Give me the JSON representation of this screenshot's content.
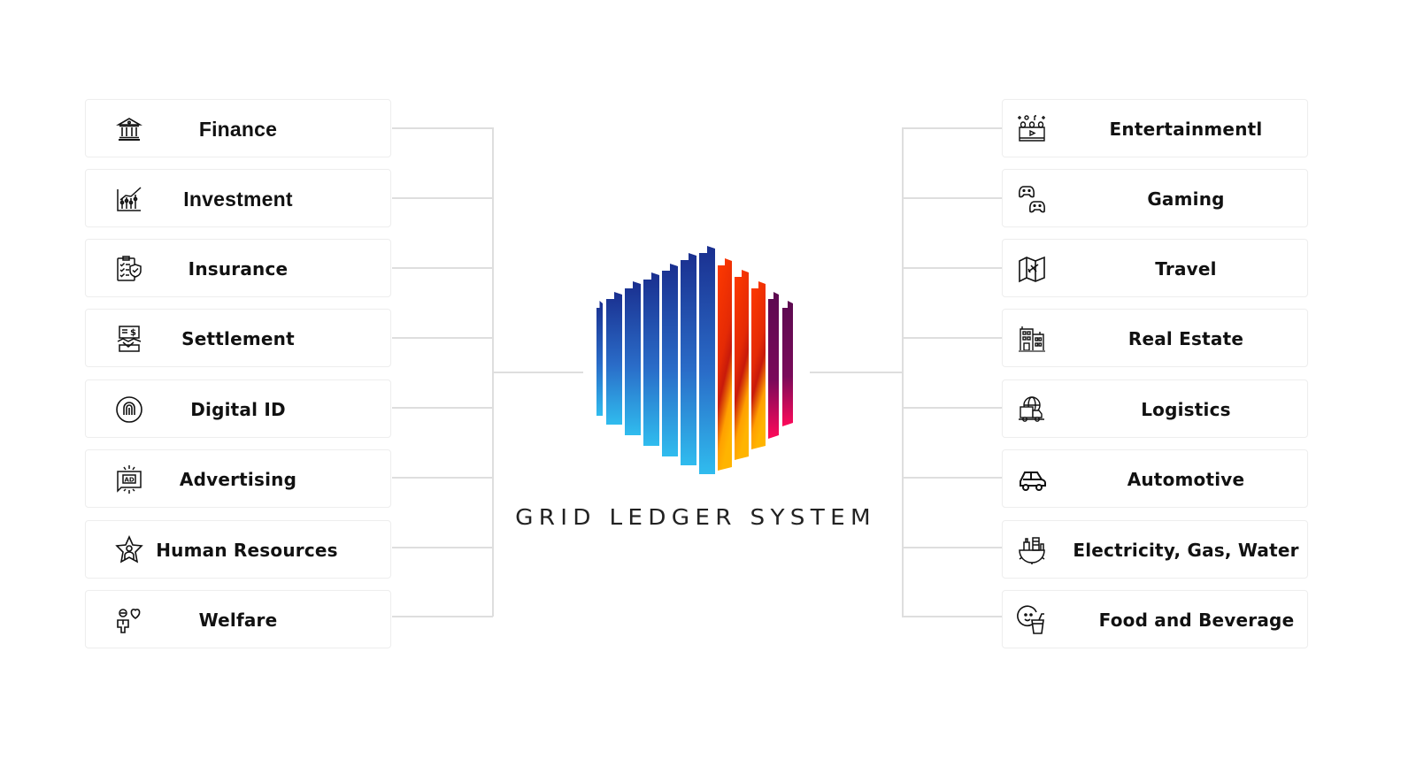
{
  "title": "GRID LEDGER SYSTEM",
  "logo": {
    "name": "grid-ledger-logo",
    "left_colors": [
      "#1a2f8f",
      "#2a7fd0",
      "#30b8ea"
    ],
    "right_colors": [
      "#ff3a00",
      "#c8160a",
      "#ffb000"
    ],
    "far_right_colors": [
      "#6a0a55",
      "#ff0a5a"
    ]
  },
  "left_items": [
    {
      "label": "Finance",
      "icon": "bank-icon"
    },
    {
      "label": "Investment",
      "icon": "stock-chart-icon"
    },
    {
      "label": "Insurance",
      "icon": "clipboard-shield-icon"
    },
    {
      "label": "Settlement",
      "icon": "handshake-bill-icon"
    },
    {
      "label": "Digital ID",
      "icon": "fingerprint-icon"
    },
    {
      "label": "Advertising",
      "icon": "ad-board-icon"
    },
    {
      "label": "Human Resources",
      "icon": "star-person-icon"
    },
    {
      "label": "Welfare",
      "icon": "person-heart-icon"
    }
  ],
  "right_items": [
    {
      "label": "Entertainmentl",
      "icon": "entertainment-icon"
    },
    {
      "label": "Gaming",
      "icon": "gamepads-icon"
    },
    {
      "label": "Travel",
      "icon": "map-plane-icon"
    },
    {
      "label": "Real Estate",
      "icon": "buildings-icon"
    },
    {
      "label": "Logistics",
      "icon": "globe-truck-icon"
    },
    {
      "label": "Automotive",
      "icon": "car-icon"
    },
    {
      "label": "Electricity, Gas, Water",
      "icon": "utility-gear-icon"
    },
    {
      "label": "Food and Beverage",
      "icon": "smiley-cup-icon"
    }
  ]
}
